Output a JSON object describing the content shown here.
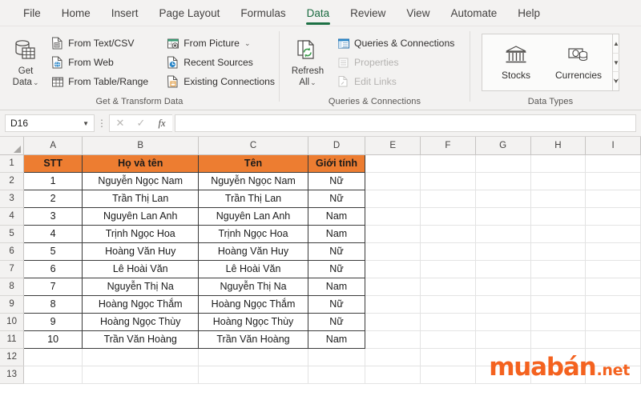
{
  "tabs": [
    {
      "label": "File",
      "active": false
    },
    {
      "label": "Home",
      "active": false
    },
    {
      "label": "Insert",
      "active": false
    },
    {
      "label": "Page Layout",
      "active": false
    },
    {
      "label": "Formulas",
      "active": false
    },
    {
      "label": "Data",
      "active": true
    },
    {
      "label": "Review",
      "active": false
    },
    {
      "label": "View",
      "active": false
    },
    {
      "label": "Automate",
      "active": false
    },
    {
      "label": "Help",
      "active": false
    }
  ],
  "ribbon": {
    "groups": [
      {
        "name": "Get & Transform Data",
        "label": "Get & Transform Data",
        "big": {
          "label_line1": "Get",
          "label_line2": "Data",
          "icon": "get-data-icon",
          "has_caret": true
        },
        "col1": [
          {
            "label": "From Text/CSV",
            "icon": "text-csv-icon",
            "disabled": false,
            "caret": false
          },
          {
            "label": "From Web",
            "icon": "web-icon",
            "disabled": false,
            "caret": false
          },
          {
            "label": "From Table/Range",
            "icon": "table-range-icon",
            "disabled": false,
            "caret": false
          }
        ],
        "col2": [
          {
            "label": "From Picture",
            "icon": "picture-icon",
            "disabled": false,
            "caret": true
          },
          {
            "label": "Recent Sources",
            "icon": "recent-sources-icon",
            "disabled": false,
            "caret": false
          },
          {
            "label": "Existing Connections",
            "icon": "existing-connections-icon",
            "disabled": false,
            "caret": false
          }
        ]
      },
      {
        "name": "Queries & Connections",
        "label": "Queries & Connections",
        "big": {
          "label_line1": "Refresh",
          "label_line2": "All",
          "icon": "refresh-all-icon",
          "has_caret": true
        },
        "col1": [
          {
            "label": "Queries & Connections",
            "icon": "queries-connections-icon",
            "disabled": false,
            "caret": false
          },
          {
            "label": "Properties",
            "icon": "properties-icon",
            "disabled": true,
            "caret": false
          },
          {
            "label": "Edit Links",
            "icon": "edit-links-icon",
            "disabled": true,
            "caret": false
          }
        ]
      },
      {
        "name": "Data Types",
        "label": "Data Types",
        "gallery": [
          {
            "label": "Stocks",
            "icon": "stocks-icon"
          },
          {
            "label": "Currencies",
            "icon": "currencies-icon"
          }
        ],
        "scroll": [
          "scroll-up-icon",
          "scroll-down-icon",
          "more-icon"
        ]
      }
    ]
  },
  "formula_bar": {
    "name_box_value": "D16",
    "cancel_icon": "cancel-x-icon",
    "enter_icon": "enter-check-icon",
    "function_icon": "fx-icon",
    "formula_value": "",
    "formula_placeholder": ""
  },
  "grid": {
    "columns": [
      "A",
      "B",
      "C",
      "D",
      "E",
      "F",
      "G",
      "H",
      "I"
    ],
    "rows": [
      "1",
      "2",
      "3",
      "4",
      "5",
      "6",
      "7",
      "8",
      "9",
      "10",
      "11",
      "12",
      "13"
    ],
    "header_fill": "#ED7D31",
    "header_row": [
      "STT",
      "Họ và tên",
      "Tên",
      "Giới tính"
    ],
    "data_rows": [
      [
        "1",
        "Nguyễn Ngọc Nam",
        "Nguyễn Ngọc Nam",
        "Nữ"
      ],
      [
        "2",
        "Trần Thị Lan",
        "Trần Thị Lan",
        "Nữ"
      ],
      [
        "3",
        "Nguyên Lan Anh",
        "Nguyên Lan Anh",
        "Nam"
      ],
      [
        "4",
        "Trịnh Ngọc Hoa",
        "Trịnh Ngọc Hoa",
        "Nam"
      ],
      [
        "5",
        "Hoàng Văn Huy",
        "Hoàng Văn Huy",
        "Nữ"
      ],
      [
        "6",
        "Lê Hoài Văn",
        "Lê Hoài Văn",
        "Nữ"
      ],
      [
        "7",
        "Nguyễn Thị Na",
        "Nguyễn Thị Na",
        "Nam"
      ],
      [
        "8",
        "Hoàng Ngọc Thắm",
        "Hoàng Ngọc Thắm",
        "Nữ"
      ],
      [
        "9",
        "Hoàng Ngọc Thùy",
        "Hoàng Ngọc Thùy",
        "Nữ"
      ],
      [
        "10",
        "Trần Văn Hoàng",
        "Trần Văn Hoàng",
        "Nam"
      ]
    ]
  },
  "watermark": {
    "text_main": "muabán",
    "text_suffix": ".net",
    "color": "#F4621F"
  }
}
